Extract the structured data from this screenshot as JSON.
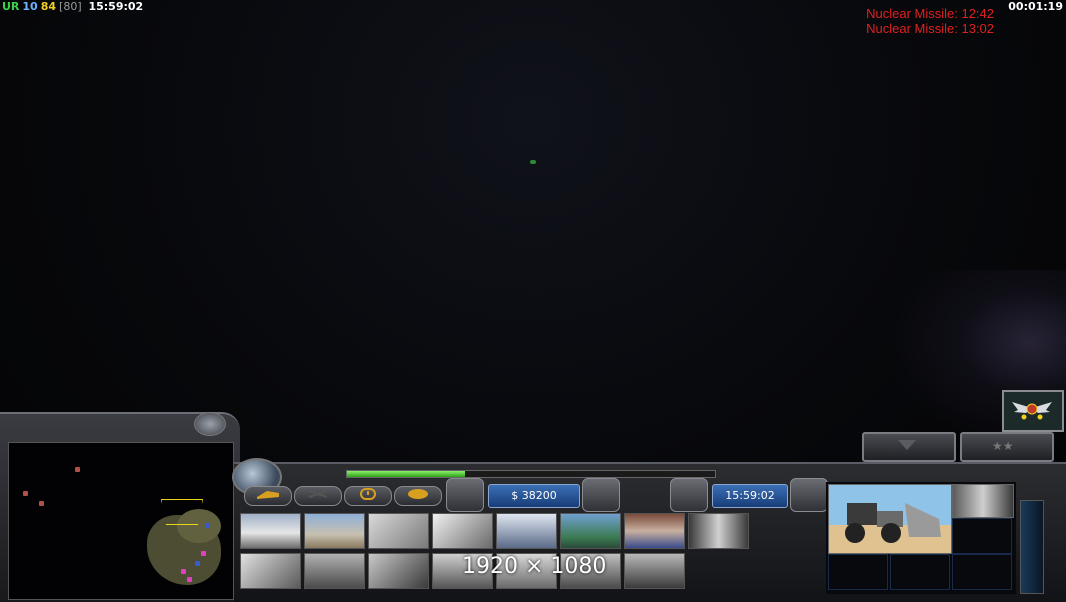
{
  "topbar": {
    "faction": "UR",
    "power": "10",
    "units": "84",
    "unit_cap": "[80]",
    "clock": "15:59:02",
    "elapsed": "00:01:19"
  },
  "alerts": [
    "Nuclear Missile: 12:42",
    "Nuclear Missile: 13:02"
  ],
  "sidebar": {
    "money": "$ 38200",
    "game_time": "15:59:02",
    "power_progress": 0.32,
    "tabs": [
      "structures",
      "defenses",
      "infantry",
      "vehicles"
    ]
  },
  "overlay": {
    "resolution": "1920 × 1080"
  },
  "build_icons": [
    "command-center",
    "barracks",
    "supply-center",
    "war-factory",
    "power-plant",
    "sam-site",
    "laser-turret",
    "silo",
    "airfield",
    "supply-drop",
    "bunker",
    "tank-hangar",
    "strategy-center",
    "fire-base"
  ],
  "selected_unit": {
    "name": "dozer"
  },
  "colors": {
    "accent_blue": "#2b5fa8",
    "alert_red": "#e02020",
    "power_green": "#3cd24a"
  }
}
